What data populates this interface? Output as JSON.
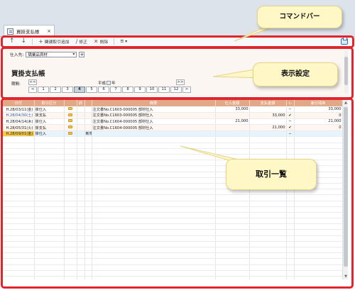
{
  "tab": {
    "title": "買掛支払帳",
    "icon": "document-icon",
    "close": "×"
  },
  "toolbar": {
    "up_icon": "↑",
    "down_icon": "↓",
    "add_related_label": "関連取引追加",
    "edit_label": "修正",
    "delete_label": "削除",
    "view_icon": "☰ ▾"
  },
  "settings": {
    "supplier_label": "仕入先:",
    "supplier_value": "矯業品資材",
    "page_title": "買掛支払帳",
    "period_label": "期間:",
    "era_label": "平成",
    "era_suffix": "年",
    "prev": "<<",
    "next": ">>",
    "months": [
      "1",
      "2",
      "3",
      "4",
      "5",
      "6",
      "7",
      "8",
      "9",
      "10",
      "11",
      "12"
    ],
    "active_month": "4"
  },
  "table": {
    "headers": [
      "日付",
      "取引区分",
      "",
      "詳",
      "",
      "摘要",
      "仕入金額",
      "支払金額",
      "レ",
      "差引残高"
    ],
    "rows": [
      {
        "date": "H.28/03/11(金)",
        "type": "掛仕入",
        "folder": true,
        "mark": "",
        "summary": "注文書No.C1603-000005 部材仕入",
        "purchase": "33,000",
        "payment": "",
        "check": "−",
        "balance": "33,000",
        "style": "normal",
        "blue": false
      },
      {
        "date": "H.28/04/30(土)",
        "type": "掛支払",
        "folder": true,
        "mark": "",
        "summary": "注文書No.C1603-000005 部材仕入",
        "purchase": "",
        "payment": "33,000",
        "check": "✔",
        "balance": "0",
        "style": "alt",
        "blue": true
      },
      {
        "date": "H.28/04/14(木)",
        "type": "掛仕入",
        "folder": true,
        "mark": "",
        "summary": "注文書No.C1604-000005 部材仕入",
        "purchase": "21,000",
        "payment": "",
        "check": "−",
        "balance": "21,000",
        "style": "normal",
        "blue": false
      },
      {
        "date": "H.28/05/31(火)",
        "type": "掛支払",
        "folder": true,
        "mark": "",
        "summary": "注文書No.C1604-000005 部材仕入",
        "purchase": "",
        "payment": "21,000",
        "check": "✔",
        "balance": "0",
        "style": "alt",
        "blue": false
      },
      {
        "date": "H.28/09/01(金)",
        "type": "掛仕入",
        "folder": true,
        "mark": "新規",
        "summary": "",
        "purchase": "",
        "payment": "",
        "check": "−",
        "balance": "",
        "style": "sel",
        "blue": false
      }
    ]
  },
  "callouts": {
    "command_bar": "コマンドバー",
    "settings": "表示設定",
    "list": "取引一覧"
  },
  "colors": {
    "annotation_border": "#e0252c",
    "callout_fill": "#fff8c6",
    "header_fill": "#e2a989",
    "highlight_date": "#f6c94a"
  }
}
